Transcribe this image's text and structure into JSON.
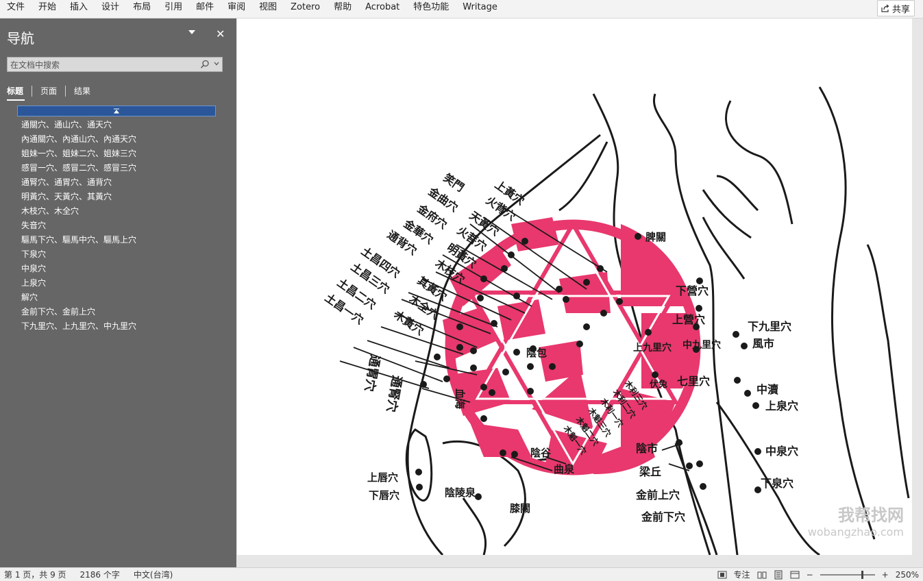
{
  "menu": [
    "文件",
    "开始",
    "插入",
    "设计",
    "布局",
    "引用",
    "邮件",
    "审阅",
    "视图",
    "Zotero",
    "帮助",
    "Acrobat",
    "特色功能",
    "Writage"
  ],
  "share_label": "共享",
  "nav": {
    "title": "导航",
    "search_placeholder": "在文档中搜索",
    "tabs": [
      "标题",
      "页面",
      "结果"
    ],
    "headings": [
      "通關穴、通山穴、通天穴",
      "內通關穴、內通山穴、內通天穴",
      "姐妹一穴、姐妹二穴、姐妹三穴",
      "感冒一穴、感冒二穴、感冒三穴",
      "通腎穴、通胃穴、通背穴",
      "明黃穴、天黃穴、其黃穴",
      "木枝穴、木全穴",
      "失音穴",
      "驅馬下穴、驅馬中穴、驅馬上穴",
      "下泉穴",
      "中泉穴",
      "上泉穴",
      "解穴",
      "金前下穴、金前上穴",
      "下九里穴、上九里穴、中九里穴"
    ]
  },
  "figure": {
    "labels_left": [
      "上黃穴",
      "火背穴",
      "笑門",
      "天黃穴",
      "金曲穴",
      "火菩穴",
      "金府穴",
      "明黃穴",
      "金華穴",
      "木枝穴",
      "通背穴",
      "其黃穴",
      "土昌四穴",
      "木全穴",
      "土昌三穴",
      "木黃穴",
      "土昌二穴",
      "土昌一穴",
      "通胃穴",
      "通腎穴"
    ],
    "labels_inside": [
      "脾關",
      "陰包",
      "血海",
      "伏兔",
      "木利三穴",
      "木利二穴",
      "木利一穴",
      "木魁三穴",
      "木魁二穴",
      "木魁一穴"
    ],
    "labels_right": [
      "下營穴",
      "上營穴",
      "上九里穴",
      "中九里穴",
      "七里穴",
      "下九里穴",
      "風市",
      "中瀆",
      "上泉穴",
      "中泉穴",
      "下泉穴",
      "陰市",
      "梁丘",
      "金前上穴",
      "金前下穴"
    ],
    "labels_bottom": [
      "陰谷",
      "曲泉",
      "上唇穴",
      "下唇穴",
      "陰陵泉",
      "膝關"
    ],
    "accent_color": "#e8386d"
  },
  "watermark": {
    "main": "我帮找网",
    "url": "wobangzhao.com"
  },
  "status": {
    "page_info": "第 1 页，共 9 页",
    "word_count": "2186 个字",
    "language": "中文(台湾)",
    "focus": "专注",
    "zoom": "250%"
  }
}
